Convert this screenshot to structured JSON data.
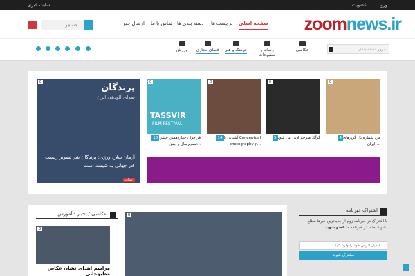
{
  "topbar": {
    "sitemap": "سایت خبری",
    "login": "ورود",
    "register": "عضویت"
  },
  "logo": {
    "zoom": "zoom",
    "news": "news.ir"
  },
  "nav": [
    "صفحه اصلی",
    "برچسب ها",
    "دسته بندی ها",
    "تماس با ما",
    "ارسال خبر"
  ],
  "search": {
    "placeholder": "جستجو ..."
  },
  "categories": [
    "عکاسی",
    "رسانه و مطبوعات",
    "فرهنگ و هنر",
    "فضای مجازی",
    "ورزش"
  ],
  "category_select": "مرور دسته بندی",
  "featured": {
    "badge": "0",
    "captions": [
      {
        "num": "4",
        "text": "مرد شماره یک گوپرهای ایران!..."
      },
      {
        "num": "5",
        "text": "گوگل مترجم ادبی می شود"
      },
      {
        "num": "14",
        "text": "آشنایی با Conceptual photography ع..."
      },
      {
        "num": "13",
        "text": "فراخوان چهاردهمین جشن تصویرسال و جش..."
      }
    ],
    "tassvir_logo": "TASSVIR",
    "tassvir_sub": "FILM FESTIVAL",
    "big": {
      "title": "پرندگان",
      "subtitle": "صدای آلودهی ایرن",
      "text": "آرمان سلاح ورزی: پرندگان شر تصویر زیست در جهانی به شیشه است!",
      "tag": "ادبیات"
    }
  },
  "newsbox": {
    "heading": "عکاسی / اخبار - آموزش",
    "item_title": "مراسم اهدای نشان عکاس مطبوعاتی"
  },
  "subscribe": {
    "heading": "اشتراک خبرنامه",
    "text": "با اشتراک در خبرنامه زوم از جدیدترین خبرها مطلع شوید، حتما در خبرنامه ما",
    "bold": "عضو شوید.",
    "email_placeholder": "ایمیل آدرس خود را وارد کنید ...",
    "button": "مشترک شوید"
  },
  "colors": {
    "accent": "#2ba2c7",
    "brand_red": "#c0202a",
    "purple_banner": "#8b1b8a"
  }
}
